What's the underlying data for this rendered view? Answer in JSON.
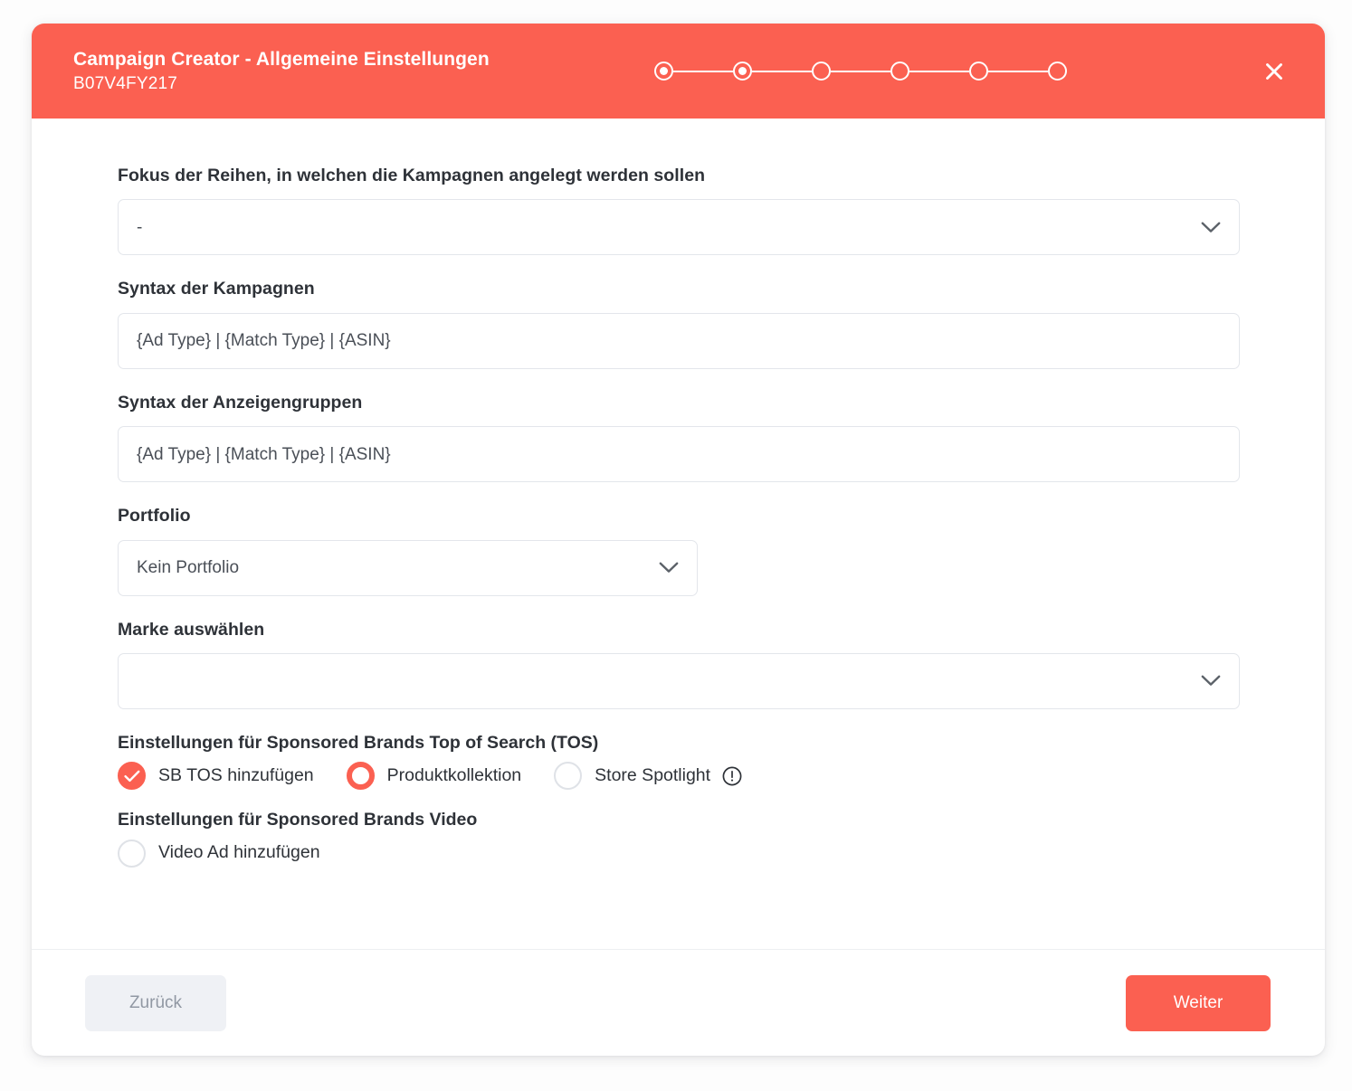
{
  "header": {
    "title": "Campaign Creator - Allgemeine Einstellungen",
    "subtitle": "B07V4FY217",
    "close_label": "×",
    "accent_color": "#fb6051",
    "stepper": {
      "total_steps": 6,
      "completed_steps": 2,
      "steps": [
        {
          "index": 1,
          "state": "filled"
        },
        {
          "index": 2,
          "state": "filled"
        },
        {
          "index": 3,
          "state": "empty"
        },
        {
          "index": 4,
          "state": "empty"
        },
        {
          "index": 5,
          "state": "empty"
        },
        {
          "index": 6,
          "state": "empty"
        }
      ]
    }
  },
  "form": {
    "focus_rows": {
      "label": "Fokus der Reihen, in welchen die Kampagnen angelegt werden sollen",
      "value": "-"
    },
    "campaign_syntax": {
      "label": "Syntax der Kampagnen",
      "value": "{Ad Type} | {Match Type} | {ASIN}"
    },
    "adgroup_syntax": {
      "label": "Syntax der Anzeigengruppen",
      "value": "{Ad Type} | {Match Type} | {ASIN}"
    },
    "portfolio": {
      "label": "Portfolio",
      "value": "Kein Portfolio"
    },
    "brand": {
      "label": "Marke auswählen",
      "value": ""
    },
    "tos_section": {
      "title": "Einstellungen für Sponsored Brands Top of Search (TOS)",
      "options": [
        {
          "label": "SB TOS hinzufügen",
          "type": "checkbox",
          "state": "checked"
        },
        {
          "label": "Produktkollektion",
          "type": "radio",
          "state": "selected"
        },
        {
          "label": "Store Spotlight",
          "type": "radio",
          "state": "unselected",
          "info": "info-icon"
        }
      ]
    },
    "video_section": {
      "title": "Einstellungen für Sponsored Brands Video",
      "options": [
        {
          "label": "Video Ad hinzufügen",
          "type": "checkbox",
          "state": "unchecked"
        }
      ]
    }
  },
  "footer": {
    "back_label": "Zurück",
    "next_label": "Weiter"
  }
}
